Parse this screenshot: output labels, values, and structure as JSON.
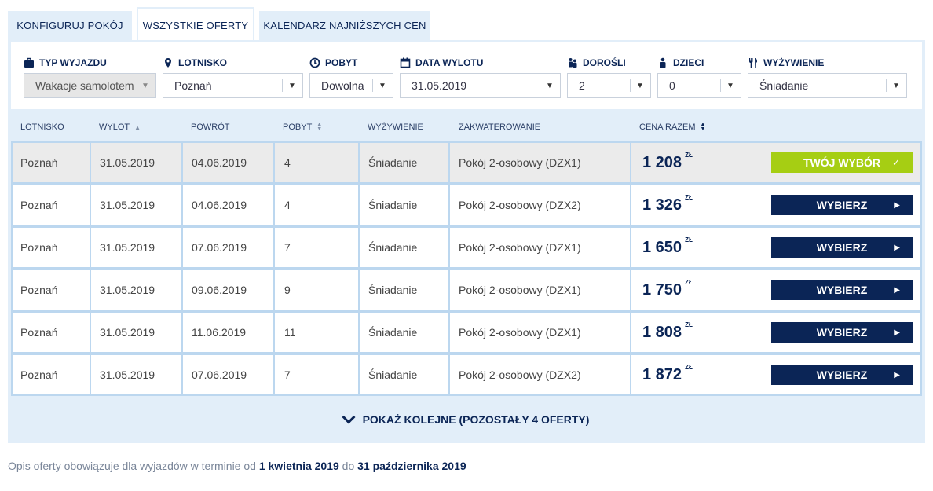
{
  "tabs": [
    {
      "label": "KONFIGURUJ POKÓJ",
      "active": false
    },
    {
      "label": "WSZYSTKIE OFERTY",
      "active": true
    },
    {
      "label": "KALENDARZ NAJNIŻSZYCH CEN",
      "active": false
    }
  ],
  "filters": {
    "trip_type": {
      "label": "TYP WYJAZDU",
      "value": "Wakacje samolotem",
      "icon": "suitcase-icon",
      "disabled": true
    },
    "airport": {
      "label": "LOTNISKO",
      "value": "Poznań",
      "icon": "map-pin-icon"
    },
    "stay": {
      "label": "POBYT",
      "value": "Dowolna",
      "icon": "clock-icon"
    },
    "departure_date": {
      "label": "DATA WYLOTU",
      "value": "31.05.2019",
      "icon": "calendar-icon"
    },
    "adults": {
      "label": "DOROŚLI",
      "value": "2",
      "icon": "adults-icon"
    },
    "children": {
      "label": "DZIECI",
      "value": "0",
      "icon": "child-icon"
    },
    "board": {
      "label": "WYŻYWIENIE",
      "value": "Śniadanie",
      "icon": "cutlery-icon"
    }
  },
  "table": {
    "headers": {
      "airport": "LOTNISKO",
      "departure": "WYLOT",
      "return": "POWRÓT",
      "stay": "POBYT",
      "board": "WYŻYWIENIE",
      "accommodation": "ZAKWATEROWANIE",
      "price": "CENA RAZEM"
    },
    "currency": "ZŁ",
    "select_label": "WYBIERZ",
    "chosen_label": "TWÓJ WYBÓR",
    "rows": [
      {
        "airport": "Poznań",
        "departure": "31.05.2019",
        "return": "04.06.2019",
        "stay": "4",
        "board": "Śniadanie",
        "room": "Pokój 2-osobowy (DZX1)",
        "price": "1 208",
        "selected": true
      },
      {
        "airport": "Poznań",
        "departure": "31.05.2019",
        "return": "04.06.2019",
        "stay": "4",
        "board": "Śniadanie",
        "room": "Pokój 2-osobowy (DZX2)",
        "price": "1 326",
        "selected": false
      },
      {
        "airport": "Poznań",
        "departure": "31.05.2019",
        "return": "07.06.2019",
        "stay": "7",
        "board": "Śniadanie",
        "room": "Pokój 2-osobowy (DZX1)",
        "price": "1 650",
        "selected": false
      },
      {
        "airport": "Poznań",
        "departure": "31.05.2019",
        "return": "09.06.2019",
        "stay": "9",
        "board": "Śniadanie",
        "room": "Pokój 2-osobowy (DZX1)",
        "price": "1 750",
        "selected": false
      },
      {
        "airport": "Poznań",
        "departure": "31.05.2019",
        "return": "11.06.2019",
        "stay": "11",
        "board": "Śniadanie",
        "room": "Pokój 2-osobowy (DZX1)",
        "price": "1 808",
        "selected": false
      },
      {
        "airport": "Poznań",
        "departure": "31.05.2019",
        "return": "07.06.2019",
        "stay": "7",
        "board": "Śniadanie",
        "room": "Pokój 2-osobowy (DZX2)",
        "price": "1 872",
        "selected": false
      }
    ]
  },
  "more_button": "POKAŻ KOLEJNE (POZOSTAŁY 4 OFERTY)",
  "footnote": {
    "prefix": "Opis oferty obowiązuje dla wyjazdów w terminie od",
    "from": "1 kwietnia 2019",
    "middle": "do",
    "to": "31 października 2019"
  },
  "colors": {
    "navy": "#0b2556",
    "panel_bg": "#e2eef9",
    "chosen_green": "#a6ce13",
    "row_border": "#bcd7ef"
  }
}
